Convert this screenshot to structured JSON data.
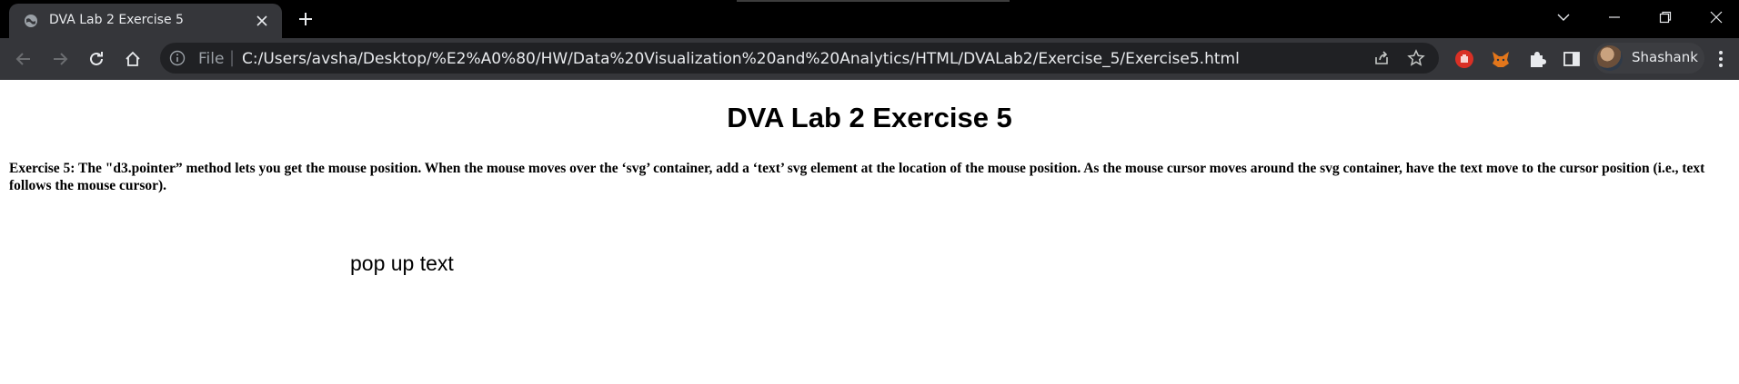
{
  "browser": {
    "tab": {
      "title": "DVA Lab 2 Exercise 5",
      "favicon": "globe-icon"
    },
    "address_bar": {
      "scheme_label": "File",
      "separator": "|",
      "url": "C:/Users/avsha/Desktop/%E2%A0%80/HW/Data%20Visualization%20and%20Analytics/HTML/DVALab2/Exercise_5/Exercise5.html"
    },
    "profile": {
      "name": "Shashank"
    },
    "colors": {
      "tabstrip": "#000000",
      "toolbar": "#35363a",
      "omnibox": "#202124",
      "text": "#e8eaed"
    }
  },
  "page": {
    "heading": "DVA Lab 2 Exercise 5",
    "description": "Exercise 5: The \"d3.pointer” method lets you get the mouse position. When the mouse moves over the ‘svg’ container, add a ‘text’ svg element at the location of the mouse position. As the mouse cursor moves around the svg container, have the text move to the cursor position (i.e., text follows the mouse cursor).",
    "popup_text": "pop up text"
  }
}
